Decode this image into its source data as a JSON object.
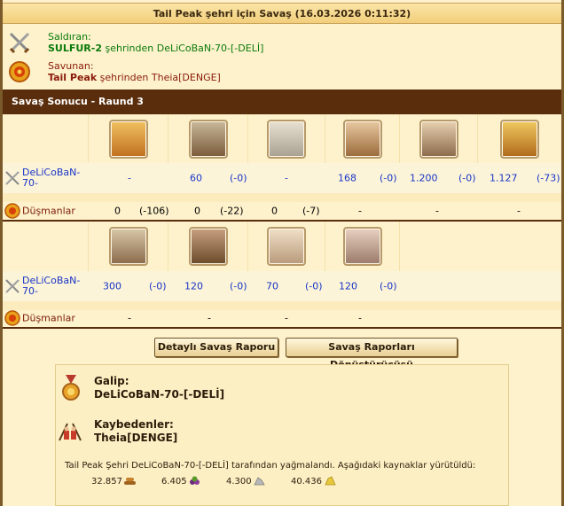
{
  "title": "Tail Peak şehri için Savaş (16.03.2026 0:11:32)",
  "attacker": {
    "label": "Saldıran:",
    "city": "SULFUR-2",
    "rest": " şehrinden DeLiCoBaN-70-[-DELİ]"
  },
  "defender": {
    "label": "Savunan:",
    "city": "Tail Peak",
    "rest": " şehrinden Theia[DENGE]"
  },
  "section_title": "Savaş Sonucu - Raund 3",
  "player_name": "DeLiCoBaN-70-",
  "enemy_label": "Düşmanlar",
  "block1": {
    "units": [
      "unit-swordsman-icon",
      "unit-ram-icon",
      "unit-wall-icon",
      "unit-slinger-icon",
      "unit-hoplite-icon",
      "unit-phalanx-icon"
    ],
    "player": [
      {
        "v": "-",
        "d": ""
      },
      {
        "v": "60",
        "d": "(-0)"
      },
      {
        "v": "-",
        "d": ""
      },
      {
        "v": "168",
        "d": "(-0)"
      },
      {
        "v": "1.200",
        "d": "(-0)"
      },
      {
        "v": "1.127",
        "d": "(-73)"
      }
    ],
    "enemy": [
      {
        "v": "0",
        "d": "(-106)"
      },
      {
        "v": "0",
        "d": "(-22)"
      },
      {
        "v": "0",
        "d": "(-7)"
      },
      {
        "v": "-",
        "d": ""
      },
      {
        "v": "-",
        "d": ""
      },
      {
        "v": "-",
        "d": ""
      }
    ]
  },
  "block2": {
    "units": [
      "unit-catapult-icon",
      "unit-mortar-icon",
      "unit-doctor-icon",
      "unit-cook-icon"
    ],
    "player": [
      {
        "v": "300",
        "d": "(-0)"
      },
      {
        "v": "120",
        "d": "(-0)"
      },
      {
        "v": "70",
        "d": "(-0)"
      },
      {
        "v": "120",
        "d": "(-0)"
      }
    ],
    "enemy": [
      {
        "v": "-",
        "d": ""
      },
      {
        "v": "-",
        "d": ""
      },
      {
        "v": "-",
        "d": ""
      },
      {
        "v": "-",
        "d": ""
      }
    ]
  },
  "buttons": {
    "detail": "Detaylı Savaş Raporu",
    "converter": "Savaş Raporları Dönüştürücüsü"
  },
  "result": {
    "winner_label": "Galip:",
    "winner": "DeLiCoBaN-70-[-DELİ]",
    "loser_label": "Kaybedenler:",
    "loser": "Theia[DENGE]",
    "loot_text": "Tail Peak Şehri DeLiCoBaN-70-[-DELİ] tarafından yağmalandı. Aşağıdaki kaynaklar yürütüldü:",
    "loot": [
      {
        "amount": "32.857",
        "icon": "wood-icon"
      },
      {
        "amount": "6.405",
        "icon": "wine-icon"
      },
      {
        "amount": "4.300",
        "icon": "marble-icon"
      },
      {
        "amount": "40.436",
        "icon": "sulfur-icon"
      }
    ]
  },
  "colors": {
    "section_bar": "#5a2d0c",
    "attacker": "#0a7a0a",
    "defender": "#8a1a0a",
    "link": "#1a35c8"
  }
}
